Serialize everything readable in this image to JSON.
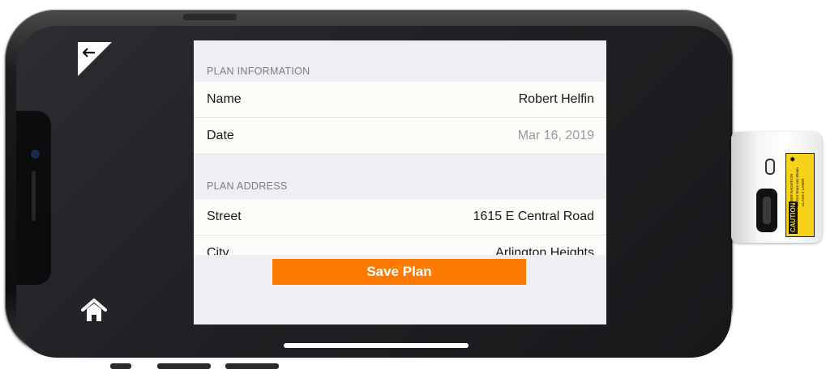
{
  "plan_information": {
    "header": "PLAN INFORMATION",
    "rows": [
      {
        "label": "Name",
        "value": "Robert Helfin"
      },
      {
        "label": "Date",
        "value": "Mar 16, 2019"
      }
    ]
  },
  "plan_address": {
    "header": "PLAN ADDRESS",
    "rows": [
      {
        "label": "Street",
        "value": "1615 E  Central Road"
      },
      {
        "label": "City",
        "value": "Arlington Heights"
      }
    ]
  },
  "save_button": {
    "label": "Save Plan"
  },
  "nav": {
    "back_icon": "back-arrow-icon",
    "home_icon": "home-icon"
  },
  "device_label": {
    "caution": "CAUTION",
    "line1": "LASER RADIATION",
    "line2": "Do Not Stare Into Beam",
    "line3": "CLASS 2 LASER"
  },
  "colors": {
    "accent": "#ff7a00",
    "header_text": "#7b7b80",
    "muted_value": "#9a9aa0"
  }
}
